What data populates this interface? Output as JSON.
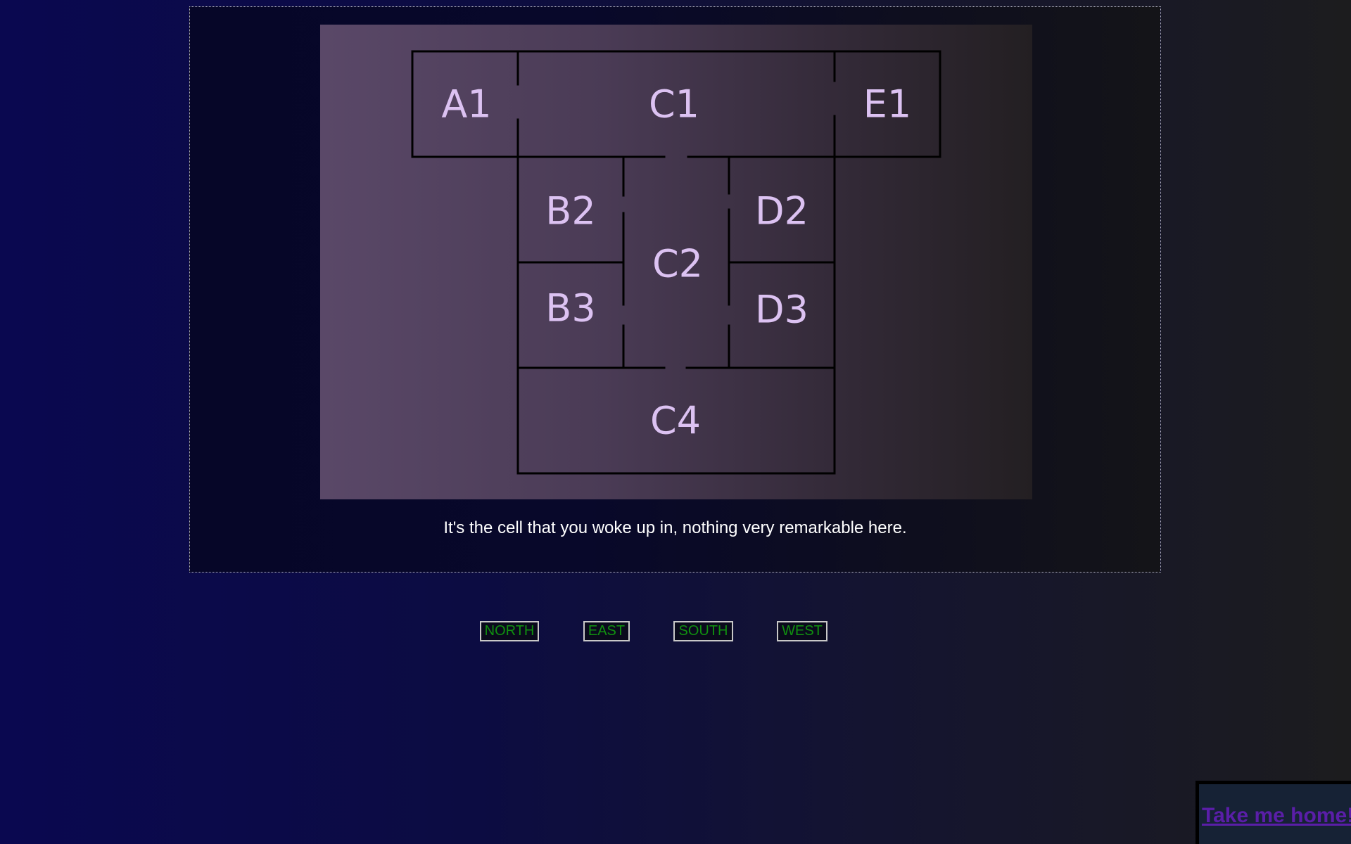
{
  "map": {
    "rooms": [
      {
        "id": "a1",
        "label": "A1"
      },
      {
        "id": "c1",
        "label": "C1"
      },
      {
        "id": "e1",
        "label": "E1"
      },
      {
        "id": "b2",
        "label": "B2"
      },
      {
        "id": "c2",
        "label": "C2"
      },
      {
        "id": "d2",
        "label": "D2"
      },
      {
        "id": "b3",
        "label": "B3"
      },
      {
        "id": "d3",
        "label": "D3"
      },
      {
        "id": "c4",
        "label": "C4"
      }
    ]
  },
  "description": "It's the cell that you woke up in, nothing very remarkable here.",
  "navigation": {
    "north": "NORTH",
    "east": "EAST",
    "south": "SOUTH",
    "west": "WEST"
  },
  "home_link": "Take me home!",
  "colors": {
    "room_label": "#dcc2f2",
    "nav_text": "#109010",
    "home_link": "#5a1ea8"
  }
}
